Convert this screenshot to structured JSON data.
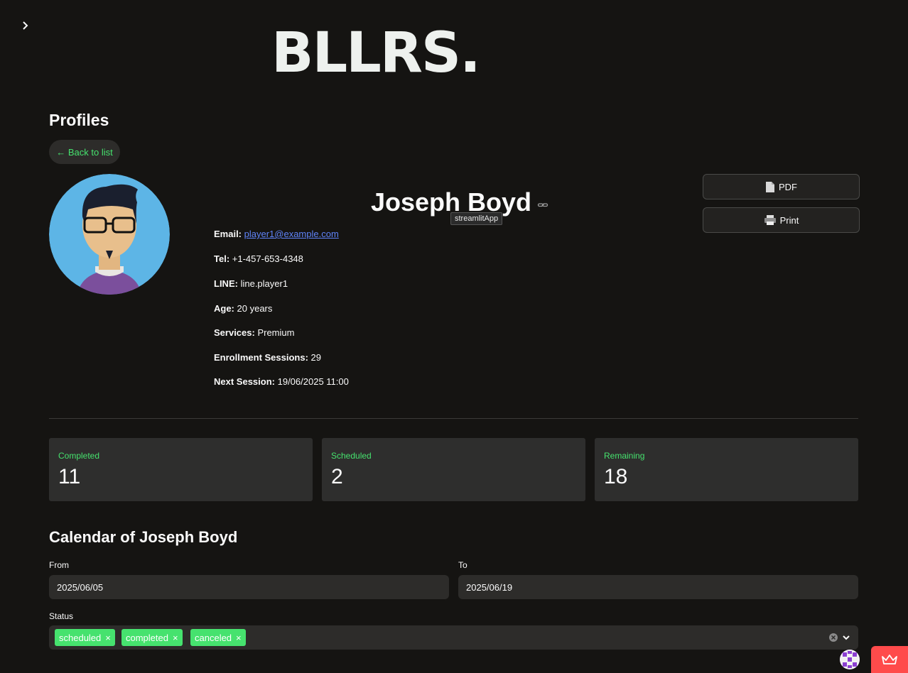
{
  "brand": {
    "logo_text": "BLLRS."
  },
  "page": {
    "title": "Profiles",
    "back_label": "← Back to list"
  },
  "profile": {
    "name": "Joseph Boyd",
    "tooltip": "streamlitApp",
    "fields": [
      {
        "label": "Email:",
        "value": "player1@example.com",
        "is_link": true
      },
      {
        "label": "Tel:",
        "value": "+1-457-653-4348"
      },
      {
        "label": "LINE:",
        "value": "line.player1"
      },
      {
        "label": "Age:",
        "value": "20 years"
      },
      {
        "label": "Services:",
        "value": "Premium"
      },
      {
        "label": "Enrollment Sessions:",
        "value": "29"
      },
      {
        "label": "Next Session:",
        "value": "19/06/2025 11:00"
      }
    ]
  },
  "actions": {
    "pdf_label": "PDF",
    "print_label": "Print"
  },
  "metrics": [
    {
      "label": "Completed",
      "value": "11"
    },
    {
      "label": "Scheduled",
      "value": "2"
    },
    {
      "label": "Remaining",
      "value": "18"
    }
  ],
  "calendar": {
    "title": "Calendar of Joseph Boyd",
    "from_label": "From",
    "from_value": "2025/06/05",
    "to_label": "To",
    "to_value": "2025/06/19",
    "status_label": "Status",
    "status_tags": [
      "scheduled",
      "completed",
      "canceled"
    ]
  },
  "colors": {
    "accent": "#46e26e",
    "background": "#151412",
    "link": "#5f83f8",
    "streamlit_red": "#ff4b4b"
  }
}
